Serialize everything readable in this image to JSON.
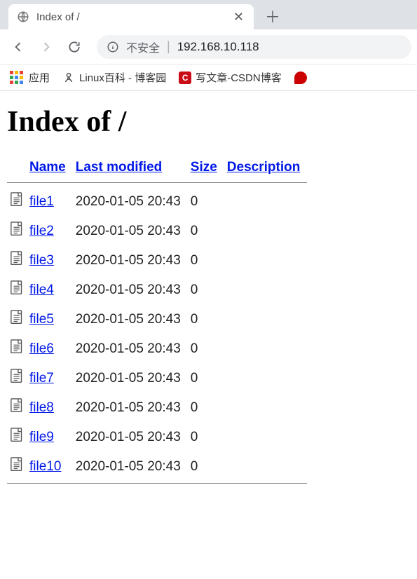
{
  "browser": {
    "tab_title": "Index of /",
    "address": {
      "not_secure_label": "不安全",
      "url": "192.168.10.118"
    },
    "bookmarks": {
      "apps_label": "应用",
      "items": [
        {
          "label": "Linux百科 - 博客园"
        },
        {
          "label": "写文章-CSDN博客"
        }
      ]
    }
  },
  "page": {
    "heading": "Index of /",
    "columns": {
      "name": "Name",
      "modified": "Last modified",
      "size": "Size",
      "description": "Description"
    },
    "files": [
      {
        "name": "file1",
        "modified": "2020-01-05 20:43",
        "size": "0"
      },
      {
        "name": "file2",
        "modified": "2020-01-05 20:43",
        "size": "0"
      },
      {
        "name": "file3",
        "modified": "2020-01-05 20:43",
        "size": "0"
      },
      {
        "name": "file4",
        "modified": "2020-01-05 20:43",
        "size": "0"
      },
      {
        "name": "file5",
        "modified": "2020-01-05 20:43",
        "size": "0"
      },
      {
        "name": "file6",
        "modified": "2020-01-05 20:43",
        "size": "0"
      },
      {
        "name": "file7",
        "modified": "2020-01-05 20:43",
        "size": "0"
      },
      {
        "name": "file8",
        "modified": "2020-01-05 20:43",
        "size": "0"
      },
      {
        "name": "file9",
        "modified": "2020-01-05 20:43",
        "size": "0"
      },
      {
        "name": "file10",
        "modified": "2020-01-05 20:43",
        "size": "0"
      }
    ]
  }
}
